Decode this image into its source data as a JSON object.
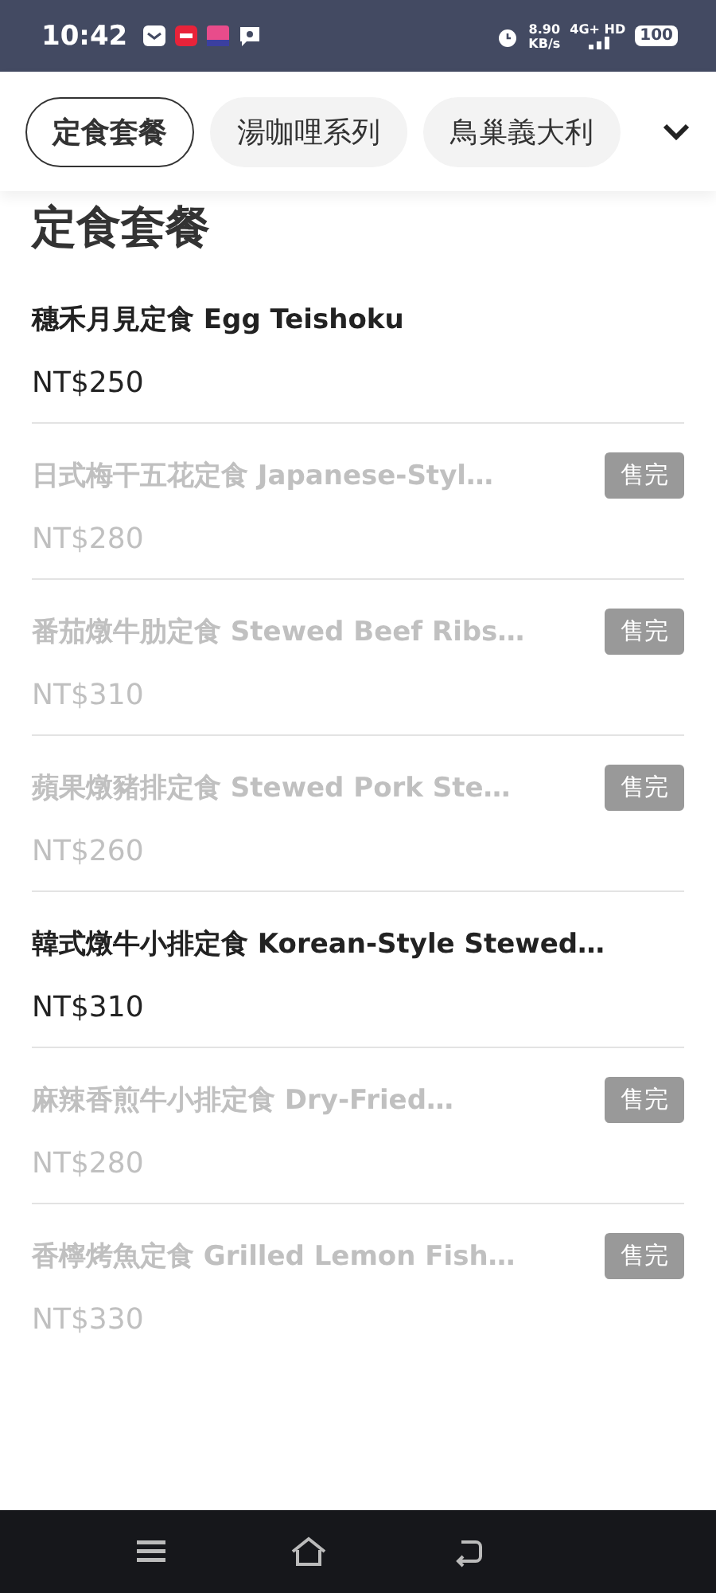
{
  "status_bar": {
    "time": "10:42",
    "speed_value": "8.90",
    "speed_unit": "KB/s",
    "network": "4G+",
    "network_extra": "HD",
    "battery": "100"
  },
  "tabs": [
    {
      "label": "定食套餐",
      "selected": true
    },
    {
      "label": "湯咖哩系列",
      "selected": false
    },
    {
      "label": "鳥巢義大利",
      "selected": false
    }
  ],
  "section_title": "定食套餐",
  "items": [
    {
      "name": "穗禾月見定食 Egg Teishoku",
      "price": "NT$250",
      "sold_out": false
    },
    {
      "name": "日式梅干五花定食 Japanese-Styl…",
      "price": "NT$280",
      "sold_out": true,
      "badge": "售完"
    },
    {
      "name": "番茄燉牛肋定食 Stewed Beef Ribs…",
      "price": "NT$310",
      "sold_out": true,
      "badge": "售完"
    },
    {
      "name": "蘋果燉豬排定食 Stewed Pork Ste…",
      "price": "NT$260",
      "sold_out": true,
      "badge": "售完"
    },
    {
      "name": "韓式燉牛小排定食 Korean-Style Stewed…",
      "price": "NT$310",
      "sold_out": false
    },
    {
      "name": "麻辣香煎牛小排定食 Dry-Fried…",
      "price": "NT$280",
      "sold_out": true,
      "badge": "售完"
    },
    {
      "name": "香檸烤魚定食 Grilled Lemon Fish…",
      "price": "NT$330",
      "sold_out": true,
      "badge": "售完"
    }
  ]
}
